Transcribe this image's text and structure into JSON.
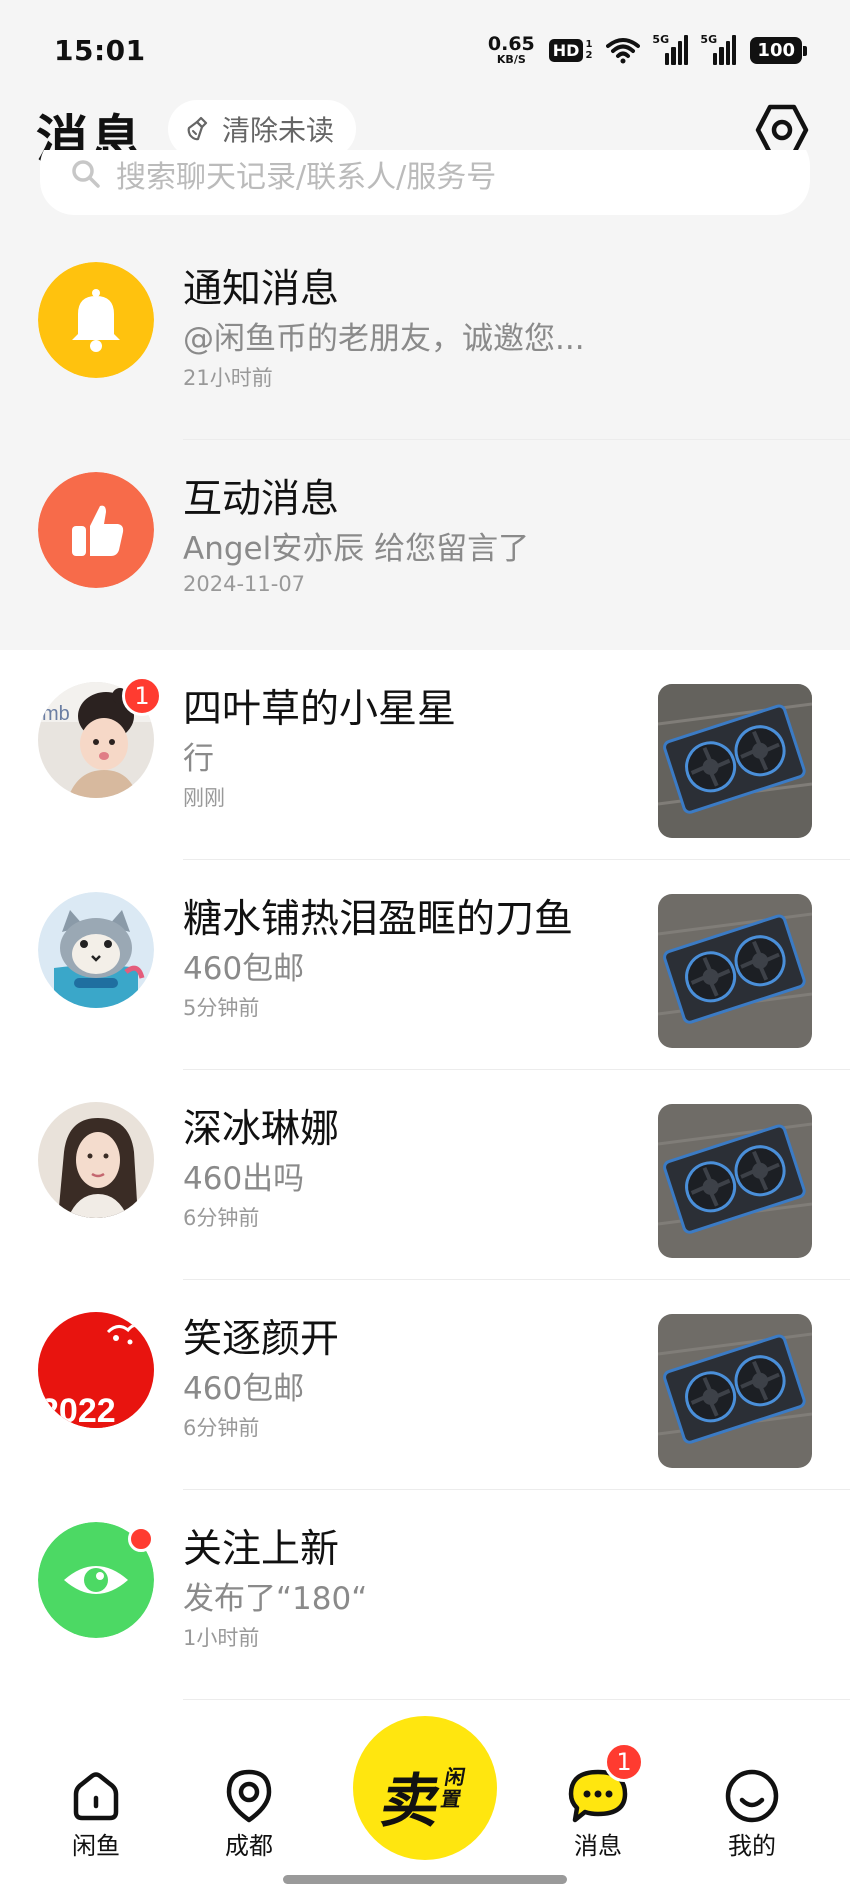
{
  "status_bar": {
    "time": "15:01",
    "net_speed_value": "0.65",
    "net_speed_unit": "KB/S",
    "hd_label": "HD",
    "hd_sub_top": "1",
    "hd_sub_bottom": "2",
    "sim1_label": "5G",
    "sim2_label": "5G",
    "battery": "100"
  },
  "header": {
    "title": "消息",
    "clear_unread_label": "清除未读",
    "settings_icon": "settings-hex-icon"
  },
  "search": {
    "placeholder": "搜索聊天记录/联系人/服务号"
  },
  "system_rows": [
    {
      "title": "通知消息",
      "subtitle": "@闲鱼币的老朋友，诚邀您...",
      "time": "21小时前",
      "icon": "bell-icon",
      "color": "#FFC20E"
    },
    {
      "title": "互动消息",
      "subtitle": "Angel安亦辰 给您留言了",
      "time": "2024-11-07",
      "icon": "thumbs-up-icon",
      "color": "#F76B4A"
    }
  ],
  "chats": [
    {
      "name": "四叶草的小星星",
      "message": "行",
      "time": "刚刚",
      "unread": "1",
      "avatar_text": "mb"
    },
    {
      "name": "糖水铺热泪盈眶的刀鱼",
      "message": "460包邮",
      "time": "5分钟前"
    },
    {
      "name": "深冰琳娜",
      "message": "460出吗",
      "time": "6分钟前"
    },
    {
      "name": "笑逐颜开",
      "message": "460包邮",
      "time": "6分钟前",
      "avatar_text": "2022"
    },
    {
      "name": "关注上新",
      "message": "发布了“180“",
      "time": "1小时前",
      "icon": "eye-icon",
      "color": "#4CD964"
    }
  ],
  "bottom_nav": {
    "items": [
      {
        "label": "闲鱼",
        "icon": "home-icon"
      },
      {
        "label": "成都",
        "icon": "location-icon"
      },
      {
        "label": "消息",
        "icon": "message-bubble-icon",
        "badge": "1"
      },
      {
        "label": "我的",
        "icon": "smile-face-icon"
      }
    ],
    "sell_main": "卖",
    "sell_small": "闲置"
  },
  "colors": {
    "accent_yellow": "#FFE60F",
    "badge_red": "#FF3B30",
    "header_background": "#F5F5F5"
  }
}
